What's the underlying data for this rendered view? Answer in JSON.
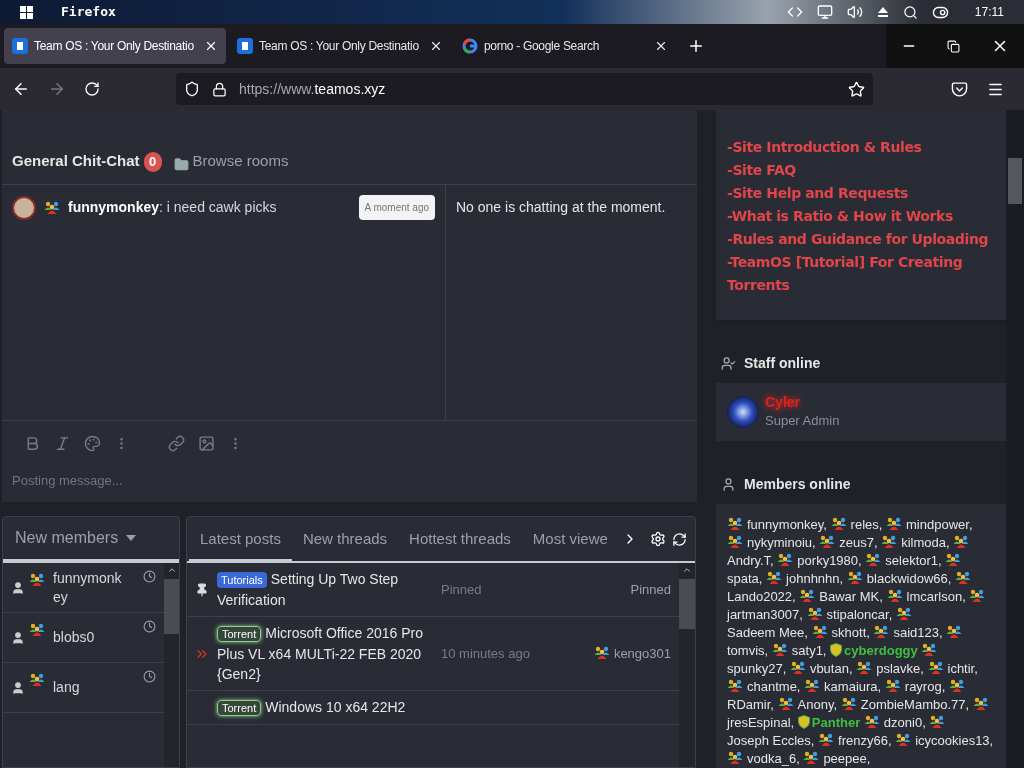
{
  "taskbar": {
    "app": "Firefox",
    "clock": "17:11"
  },
  "tabs": [
    {
      "title": "Team OS : Your Only Destinatio",
      "selected": true,
      "kind": "site"
    },
    {
      "title": "Team OS : Your Only Destinatio",
      "selected": false,
      "kind": "site"
    },
    {
      "title": "porno - Google Search",
      "selected": false,
      "kind": "google"
    }
  ],
  "address_bar": {
    "prefix": "https://www.",
    "domain": "teamos.xyz"
  },
  "chat": {
    "room": "General Chit-Chat",
    "count": "0",
    "browse": "Browse rooms",
    "messages": [
      {
        "user": "funnymonkey",
        "text": ": i need cawk picks",
        "time": "A moment ago"
      }
    ],
    "active_users": "No one is chatting at the moment.",
    "placeholder": "Posting message..."
  },
  "new_members": {
    "title": "New members",
    "items": [
      {
        "name": "funnymonkey"
      },
      {
        "name": "blobs0"
      },
      {
        "name": "lang"
      }
    ]
  },
  "posts": {
    "tabs": [
      {
        "label": "Latest posts",
        "selected": true
      },
      {
        "label": "New threads",
        "selected": false
      },
      {
        "label": "Hottest threads",
        "selected": false
      },
      {
        "label": "Most viewe",
        "selected": false
      }
    ],
    "rows": [
      {
        "kind": "pinned",
        "prefix": "Tutorials",
        "title": "Setting Up Two Step Verification",
        "time": "Pinned",
        "user": "Pinned"
      },
      {
        "kind": "torrent",
        "prefix": "Torrent",
        "title": "Microsoft Office 2016 Pro Plus VL x64 MULTi-22 FEB 2020 {Gen2}",
        "time": "10 minutes ago",
        "user": "kengo301"
      },
      {
        "kind": "torrent",
        "prefix": "Torrent",
        "title": "Windows 10 x64 22H2",
        "time": "",
        "user": ""
      }
    ]
  },
  "links": [
    "-Site Introduction & Rules",
    "-Site FAQ",
    "-Site Help and Requests",
    "-What is Ratio & How it Works",
    "-Rules and Guidance for Uploading",
    "-TeamOS [Tutorial] For Creating Torrents"
  ],
  "staff_online": {
    "title": "Staff online",
    "name": "Cyler",
    "role": "Super Admin"
  },
  "members_online": {
    "title": "Members online",
    "members": [
      {
        "name": "funnymonkey,",
        "kind": "member"
      },
      {
        "name": "reles,",
        "kind": "member"
      },
      {
        "name": "mindpower,",
        "kind": "member"
      },
      {
        "name": "nykyminoiu,",
        "kind": "member"
      },
      {
        "name": "zeus7,",
        "kind": "member"
      },
      {
        "name": "kilmoda,",
        "kind": "member"
      },
      {
        "name": "Andry.T,",
        "kind": "member"
      },
      {
        "name": "porky1980,",
        "kind": "member"
      },
      {
        "name": "selektor1,",
        "kind": "member"
      },
      {
        "name": "spata,",
        "kind": "member"
      },
      {
        "name": "johnhnhn,",
        "kind": "member"
      },
      {
        "name": "blackwidow66,",
        "kind": "member"
      },
      {
        "name": "Lando2022,",
        "kind": "member"
      },
      {
        "name": "Bawar MK,",
        "kind": "member"
      },
      {
        "name": "lmcarlson,",
        "kind": "member"
      },
      {
        "name": "jartman3007,",
        "kind": "member"
      },
      {
        "name": "stipaloncar,",
        "kind": "member"
      },
      {
        "name": "Sadeem Mee,",
        "kind": "member"
      },
      {
        "name": "skhott,",
        "kind": "member"
      },
      {
        "name": "said123,",
        "kind": "member"
      },
      {
        "name": "tomvis,",
        "kind": "member"
      },
      {
        "name": "saty1,",
        "kind": "member"
      },
      {
        "name": "cyberdoggy",
        "kind": "staff"
      },
      {
        "name": "spunky27,",
        "kind": "member"
      },
      {
        "name": "vbutan,",
        "kind": "member"
      },
      {
        "name": "pslavke,",
        "kind": "member"
      },
      {
        "name": "ichtir,",
        "kind": "member"
      },
      {
        "name": "chantme,",
        "kind": "member"
      },
      {
        "name": "kamaiura,",
        "kind": "member"
      },
      {
        "name": "rayrog,",
        "kind": "member"
      },
      {
        "name": "RDamir,",
        "kind": "member"
      },
      {
        "name": "Anony,",
        "kind": "member"
      },
      {
        "name": "ZombieMambo.77,",
        "kind": "member"
      },
      {
        "name": "jresEspinal,",
        "kind": "member"
      },
      {
        "name": "Panther",
        "kind": "staff"
      },
      {
        "name": "dzoni0,",
        "kind": "member"
      },
      {
        "name": "Joseph Eccles,",
        "kind": "member"
      },
      {
        "name": "frenzy66,",
        "kind": "member"
      },
      {
        "name": "icycookies13,",
        "kind": "member"
      },
      {
        "name": "vodka_6,",
        "kind": "member"
      },
      {
        "name": "peepee,",
        "kind": "member"
      }
    ]
  }
}
